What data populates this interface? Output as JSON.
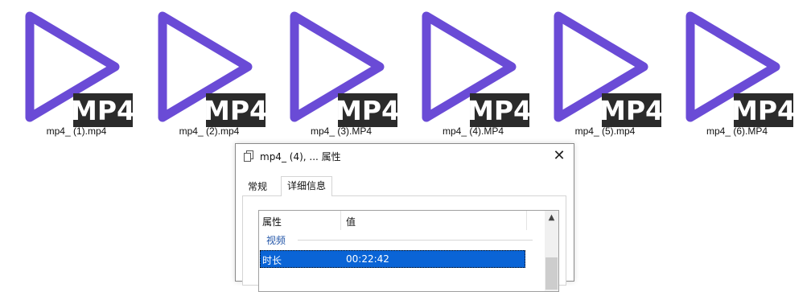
{
  "files": [
    {
      "name": "mp4_ (1).mp4",
      "badge": "MP4"
    },
    {
      "name": "mp4_ (2).mp4",
      "badge": "MP4"
    },
    {
      "name": "mp4_ (3).MP4",
      "badge": "MP4"
    },
    {
      "name": "mp4_ (4).MP4",
      "badge": "MP4"
    },
    {
      "name": "mp4_ (5).mp4",
      "badge": "MP4"
    },
    {
      "name": "mp4_ (6).MP4",
      "badge": "MP4"
    }
  ],
  "colors": {
    "play_icon": "#6a4bd6",
    "badge_bg": "#2b2b2b",
    "badge_text": "#ffffff",
    "selection": "#0a64d6",
    "group_text": "#2255a8"
  },
  "dialog": {
    "title": "mp4_ (4), ... 属性",
    "close_icon": "close-icon",
    "tabs": [
      {
        "label": "常规",
        "active": false
      },
      {
        "label": "详细信息",
        "active": true
      }
    ],
    "columns": {
      "property": "属性",
      "value": "值"
    },
    "group": "视频",
    "selected_row": {
      "property": "时长",
      "value": "00:22:42"
    }
  }
}
